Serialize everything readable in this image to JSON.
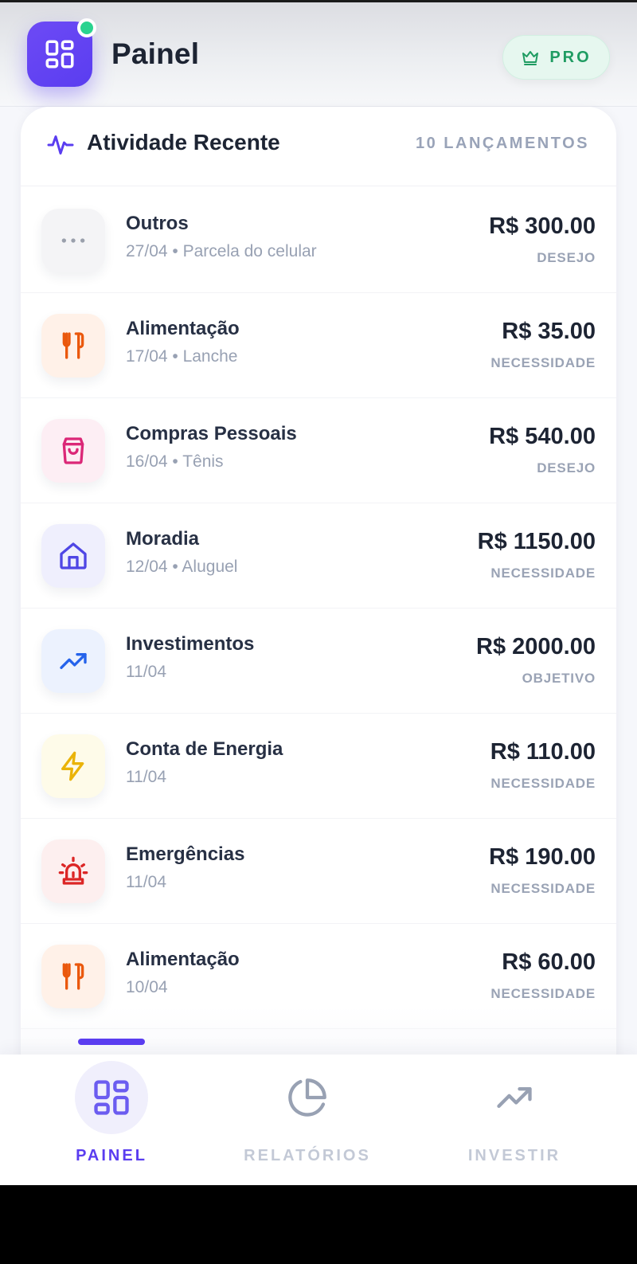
{
  "header": {
    "title": "Painel",
    "badge_label": "PRO"
  },
  "activity": {
    "title": "Atividade Recente",
    "count_label": "10 LANÇAMENTOS",
    "items": [
      {
        "category": "Outros",
        "meta": "27/04 • Parcela do celular",
        "amount": "R$ 300.00",
        "tag": "DESEJO",
        "icon": "more-dots-icon",
        "color": "#9aa0ac",
        "bg": "#f4f4f6"
      },
      {
        "category": "Alimentação",
        "meta": "17/04 • Lanche",
        "amount": "R$ 35.00",
        "tag": "NECESSIDADE",
        "icon": "utensils-icon",
        "color": "#ea580c",
        "bg": "#fff1e8"
      },
      {
        "category": "Compras Pessoais",
        "meta": "16/04 • Tênis",
        "amount": "R$ 540.00",
        "tag": "DESEJO",
        "icon": "shopping-bag-icon",
        "color": "#db2777",
        "bg": "#fdeef4"
      },
      {
        "category": "Moradia",
        "meta": "12/04 • Aluguel",
        "amount": "R$ 1150.00",
        "tag": "NECESSIDADE",
        "icon": "home-icon",
        "color": "#4f46e5",
        "bg": "#efeffd"
      },
      {
        "category": "Investimentos",
        "meta": "11/04",
        "amount": "R$ 2000.00",
        "tag": "OBJETIVO",
        "icon": "trending-up-icon",
        "color": "#2563eb",
        "bg": "#ecf2fe"
      },
      {
        "category": "Conta de Energia",
        "meta": "11/04",
        "amount": "R$ 110.00",
        "tag": "NECESSIDADE",
        "icon": "lightning-icon",
        "color": "#eab308",
        "bg": "#fefbe9"
      },
      {
        "category": "Emergências",
        "meta": "11/04",
        "amount": "R$ 190.00",
        "tag": "NECESSIDADE",
        "icon": "siren-icon",
        "color": "#dc2626",
        "bg": "#fdefef"
      },
      {
        "category": "Alimentação",
        "meta": "10/04",
        "amount": "R$ 60.00",
        "tag": "NECESSIDADE",
        "icon": "utensils-icon",
        "color": "#ea580c",
        "bg": "#fff1e8"
      }
    ]
  },
  "nav": {
    "items": [
      {
        "label": "PAINEL",
        "icon": "dashboard-grid-icon",
        "active": true
      },
      {
        "label": "RELATÓRIOS",
        "icon": "pie-chart-icon",
        "active": false
      },
      {
        "label": "INVESTIR",
        "icon": "trending-up-icon",
        "active": false
      }
    ]
  },
  "colors": {
    "accent": "#5a3df0",
    "pro_green": "#1f9c62",
    "online": "#2ad38f"
  }
}
